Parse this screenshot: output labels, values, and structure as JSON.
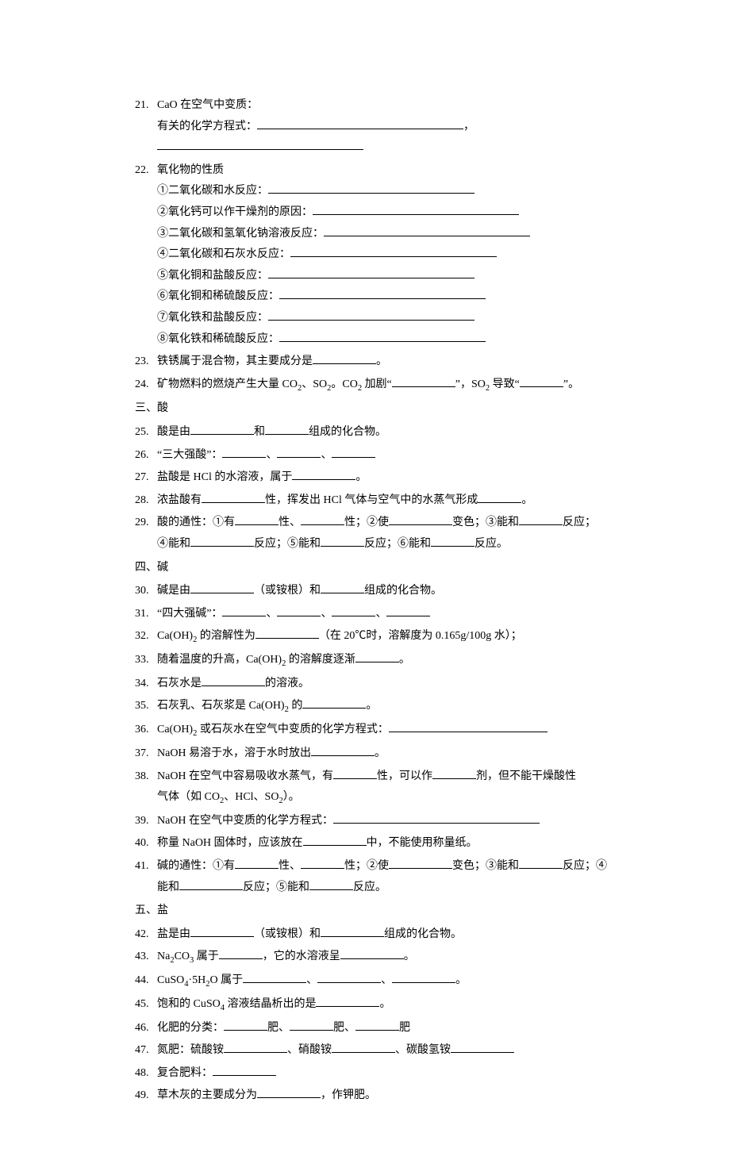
{
  "items": [
    {
      "num": "21.",
      "lines": [
        "CaO 在空气中变质：",
        "有关的化学方程式：{xlong}，{xlong}"
      ]
    },
    {
      "num": "22.",
      "lines": [
        "氧化物的性质",
        "①二氧化碳和水反应：{xlong}",
        "②氧化钙可以作干燥剂的原因：{xlong}",
        "③二氧化碳和氢氧化钠溶液反应：{xlong}",
        "④二氧化碳和石灰水反应：{xlong}",
        "⑤氧化铜和盐酸反应：{xlong}",
        "⑥氧化铜和稀硫酸反应：{xlong}",
        "⑦氧化铁和盐酸反应：{xlong}",
        "⑧氧化铁和稀硫酸反应：{xlong}"
      ]
    },
    {
      "num": "23.",
      "lines": [
        "铁锈属于混合物，其主要成分是{med}。"
      ]
    },
    {
      "num": "24.",
      "lines": [
        "矿物燃料的燃烧产生大量 CO{sub2}、SO{sub2}。CO{sub2} 加剧“{med}”，SO{sub2} 导致“{short}”。"
      ]
    },
    {
      "section": "三、酸"
    },
    {
      "num": "25.",
      "lines": [
        "酸是由{med}和{short}组成的化合物。"
      ]
    },
    {
      "num": "26.",
      "lines": [
        "“三大强酸”：{short}、{short}、{short}"
      ]
    },
    {
      "num": "27.",
      "lines": [
        "盐酸是 HCl 的水溶液，属于{med}。"
      ]
    },
    {
      "num": "28.",
      "lines": [
        "浓盐酸有{med}性，挥发出 HCl 气体与空气中的水蒸气形成{short}。"
      ]
    },
    {
      "num": "29.",
      "lines": [
        "酸的通性：①有{short}性、{short}性；②使{med}变色；③能和{short}反应；",
        "④能和{med}反应；⑤能和{short}反应；⑥能和{short}反应。"
      ]
    },
    {
      "section": "四、碱"
    },
    {
      "num": "30.",
      "lines": [
        "碱是由{med}（或铵根）和{short}组成的化合物。"
      ]
    },
    {
      "num": "31.",
      "lines": [
        "“四大强碱”：{short}、{short}、{short}、{short}"
      ]
    },
    {
      "num": "32.",
      "lines": [
        "Ca(OH){sub2} 的溶解性为{med}（在 20℃时，溶解度为 0.165g/100g 水）；"
      ]
    },
    {
      "num": "33.",
      "lines": [
        "随着温度的升高，Ca(OH){sub2} 的溶解度逐渐{short}。"
      ]
    },
    {
      "num": "34.",
      "lines": [
        "石灰水是{med}的溶液。"
      ]
    },
    {
      "num": "35.",
      "lines": [
        "石灰乳、石灰浆是 Ca(OH){sub2} 的{med}。"
      ]
    },
    {
      "num": "36.",
      "lines": [
        "Ca(OH){sub2} 或石灰水在空气中变质的化学方程式：{long}"
      ]
    },
    {
      "num": "37.",
      "lines": [
        "NaOH 易溶于水，溶于水时放出{med}。"
      ]
    },
    {
      "num": "38.",
      "lines": [
        "NaOH 在空气中容易吸收水蒸气，有{short}性，可以作{short}剂，但不能干燥酸性",
        "气体（如 CO{sub2}、HCl、SO{sub2}）。"
      ]
    },
    {
      "num": "39.",
      "lines": [
        "NaOH 在空气中变质的化学方程式：{xlong}"
      ]
    },
    {
      "num": "40.",
      "lines": [
        "称量 NaOH 固体时，应该放在{med}中，不能使用称量纸。"
      ]
    },
    {
      "num": "41.",
      "lines": [
        "碱的通性：①有{short}性、{short}性；②使{med}变色；③能和{short}反应；④",
        "能和{med}反应；⑤能和{short}反应。"
      ]
    },
    {
      "section": "五、盐"
    },
    {
      "num": "42.",
      "lines": [
        "盐是由{med}（或铵根）和{med}组成的化合物。"
      ]
    },
    {
      "num": "43.",
      "lines": [
        "Na{sub2}CO{sub3} 属于{short}，它的水溶液呈{med}。"
      ]
    },
    {
      "num": "44.",
      "lines": [
        "CuSO{sub4}·5H{sub2}O 属于{med}、{med}、{med}。"
      ]
    },
    {
      "num": "45.",
      "lines": [
        "饱和的 CuSO{sub4} 溶液结晶析出的是{med}。"
      ]
    },
    {
      "num": "46.",
      "lines": [
        "化肥的分类：{short}肥、{short}肥、{short}肥"
      ]
    },
    {
      "num": "47.",
      "lines": [
        "氮肥：硫酸铵{med}、硝酸铵{med}、碳酸氢铵{med}"
      ]
    },
    {
      "num": "48.",
      "lines": [
        "复合肥料：{med}"
      ]
    },
    {
      "num": "49.",
      "lines": [
        "草木灰的主要成分为{med}，作钾肥。"
      ]
    }
  ]
}
